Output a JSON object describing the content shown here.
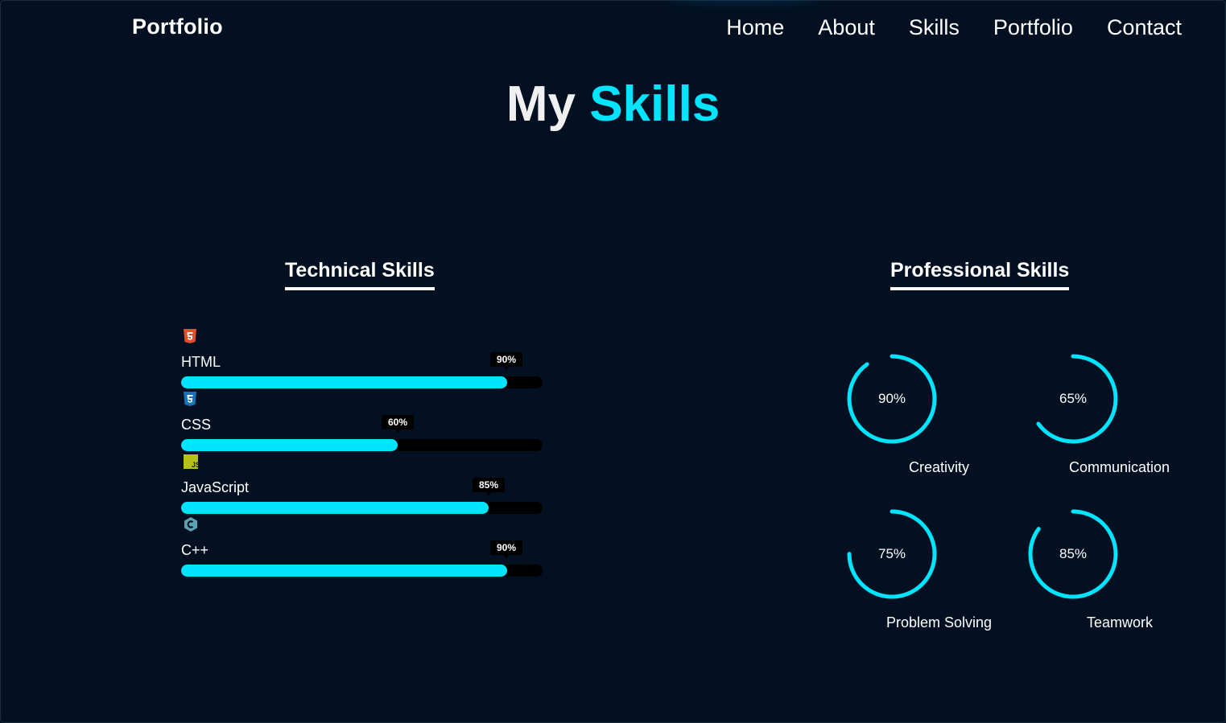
{
  "nav": {
    "logo": "Portfolio",
    "links": [
      "Home",
      "About",
      "Skills",
      "Portfolio",
      "Contact"
    ]
  },
  "hero": {
    "title_part1": "My",
    "title_part2": "Skills"
  },
  "colors": {
    "accent": "#00e5ff",
    "background": "#021022",
    "track": "#000000"
  },
  "technical": {
    "heading": "Technical Skills",
    "skills": [
      {
        "name": "HTML",
        "percent_label": "90%",
        "value": 90,
        "icon": "html5-icon"
      },
      {
        "name": "CSS",
        "percent_label": "60%",
        "value": 60,
        "icon": "css3-icon"
      },
      {
        "name": "JavaScript",
        "percent_label": "85%",
        "value": 85,
        "icon": "javascript-icon"
      },
      {
        "name": "C++",
        "percent_label": "90%",
        "value": 90,
        "icon": "cplusplus-icon"
      }
    ]
  },
  "professional": {
    "heading": "Professional Skills",
    "skills": [
      {
        "name": "Creativity",
        "percent_label": "90%",
        "value": 90
      },
      {
        "name": "Communication",
        "percent_label": "65%",
        "value": 65
      },
      {
        "name": "Problem Solving",
        "percent_label": "75%",
        "value": 75
      },
      {
        "name": "Teamwork",
        "percent_label": "85%",
        "value": 85
      }
    ]
  }
}
